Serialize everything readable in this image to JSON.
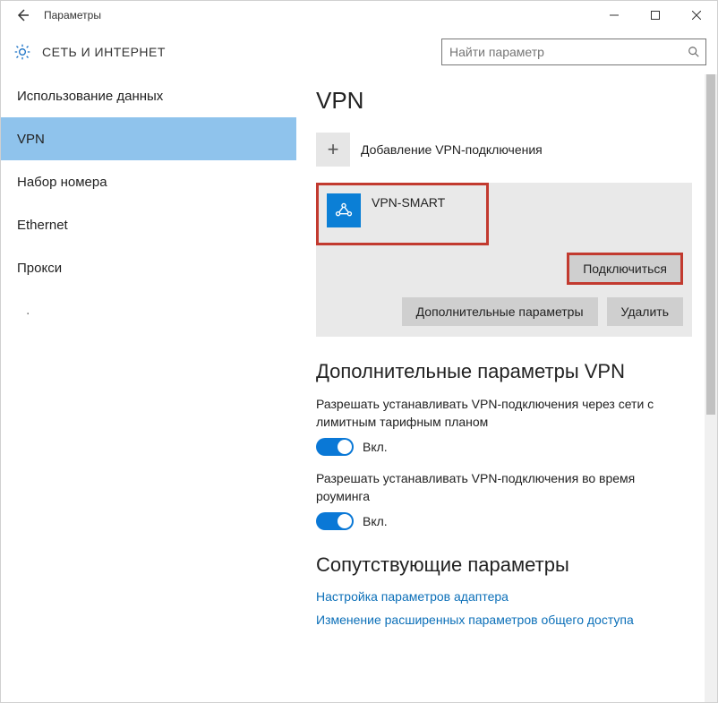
{
  "window": {
    "title": "Параметры"
  },
  "header": {
    "section_title": "СЕТЬ И ИНТЕРНЕТ",
    "search_placeholder": "Найти параметр"
  },
  "sidebar": {
    "items": [
      {
        "label": "Использование данных"
      },
      {
        "label": "VPN"
      },
      {
        "label": "Набор номера"
      },
      {
        "label": "Ethernet"
      },
      {
        "label": "Прокси"
      }
    ]
  },
  "main": {
    "page_title": "VPN",
    "add_vpn_label": "Добавление VPN-подключения",
    "connection": {
      "name": "VPN-SMART",
      "connect_button": "Подключиться",
      "advanced_button": "Дополнительные параметры",
      "delete_button": "Удалить"
    },
    "extra_heading": "Дополнительные параметры VPN",
    "settings": [
      {
        "label": "Разрешать устанавливать VPN-подключения через сети с лимитным тарифным планом",
        "state": "Вкл."
      },
      {
        "label": "Разрешать устанавливать VPN-подключения во время роуминга",
        "state": "Вкл."
      }
    ],
    "related_heading": "Сопутствующие параметры",
    "links": [
      {
        "label": "Настройка параметров адаптера"
      },
      {
        "label": "Изменение расширенных параметров общего доступа"
      }
    ]
  }
}
